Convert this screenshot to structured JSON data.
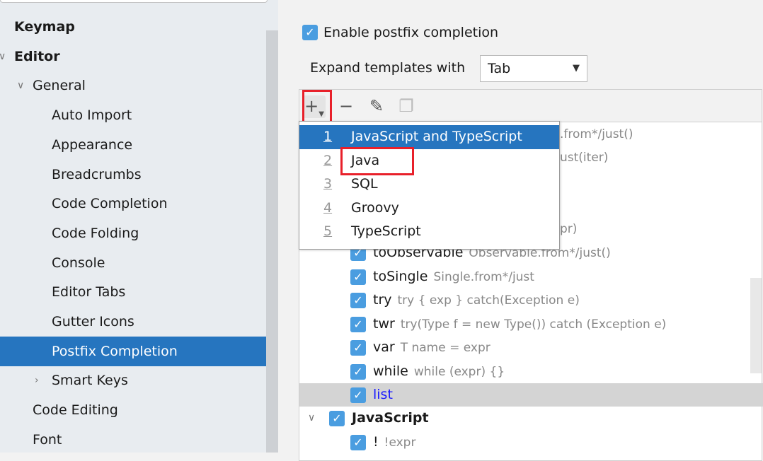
{
  "sidebar": {
    "items": [
      {
        "label": "Keymap",
        "bold": true
      },
      {
        "label": "Editor",
        "bold": true,
        "expanded": true
      },
      {
        "label": "General",
        "expanded": true
      },
      {
        "label": "Auto Import"
      },
      {
        "label": "Appearance"
      },
      {
        "label": "Breadcrumbs"
      },
      {
        "label": "Code Completion"
      },
      {
        "label": "Code Folding"
      },
      {
        "label": "Console"
      },
      {
        "label": "Editor Tabs"
      },
      {
        "label": "Gutter Icons"
      },
      {
        "label": "Postfix Completion",
        "selected": true
      },
      {
        "label": "Smart Keys",
        "collapsed": true
      },
      {
        "label": "Code Editing"
      },
      {
        "label": "Font"
      }
    ]
  },
  "main": {
    "enable_label": "Enable postfix completion",
    "enable_checked": true,
    "expand_label": "Expand templates with",
    "expand_value": "Tab",
    "toolbar": {
      "add": "plus-dropdown-icon",
      "remove": "minus-icon",
      "edit": "pencil-icon",
      "copy": "copy-icon"
    },
    "rows": [
      {
        "name": "",
        "desc": ".from*/just()"
      },
      {
        "name": "",
        "desc": "ust(iter)"
      },
      {
        "name": "",
        "desc": ""
      },
      {
        "name": "",
        "desc": ""
      },
      {
        "name": "",
        "desc": "pr)"
      },
      {
        "name": "toObservable",
        "desc": "Observable.from*/just()"
      },
      {
        "name": "toSingle",
        "desc": "Single.from*/just"
      },
      {
        "name": "try",
        "desc": "try { exp } catch(Exception e)"
      },
      {
        "name": "twr",
        "desc": "try(Type f = new Type()) catch (Exception e)"
      },
      {
        "name": "var",
        "desc": "T name = expr"
      },
      {
        "name": "while",
        "desc": "while (expr) {}"
      },
      {
        "name": "list",
        "desc": "",
        "highlighted": true
      },
      {
        "name": "JavaScript",
        "desc": "",
        "group": true
      },
      {
        "name": "!",
        "desc": "!expr"
      }
    ],
    "popup": [
      {
        "num": "1",
        "label": "JavaScript and TypeScript",
        "selected": true
      },
      {
        "num": "2",
        "label": "Java"
      },
      {
        "num": "3",
        "label": "SQL"
      },
      {
        "num": "4",
        "label": "Groovy"
      },
      {
        "num": "5",
        "label": "TypeScript"
      }
    ]
  },
  "colors": {
    "selection": "#2675bf",
    "checkbox": "#4a9de0",
    "highlight_box": "#e8202a",
    "new_template": "#1a1aff"
  }
}
